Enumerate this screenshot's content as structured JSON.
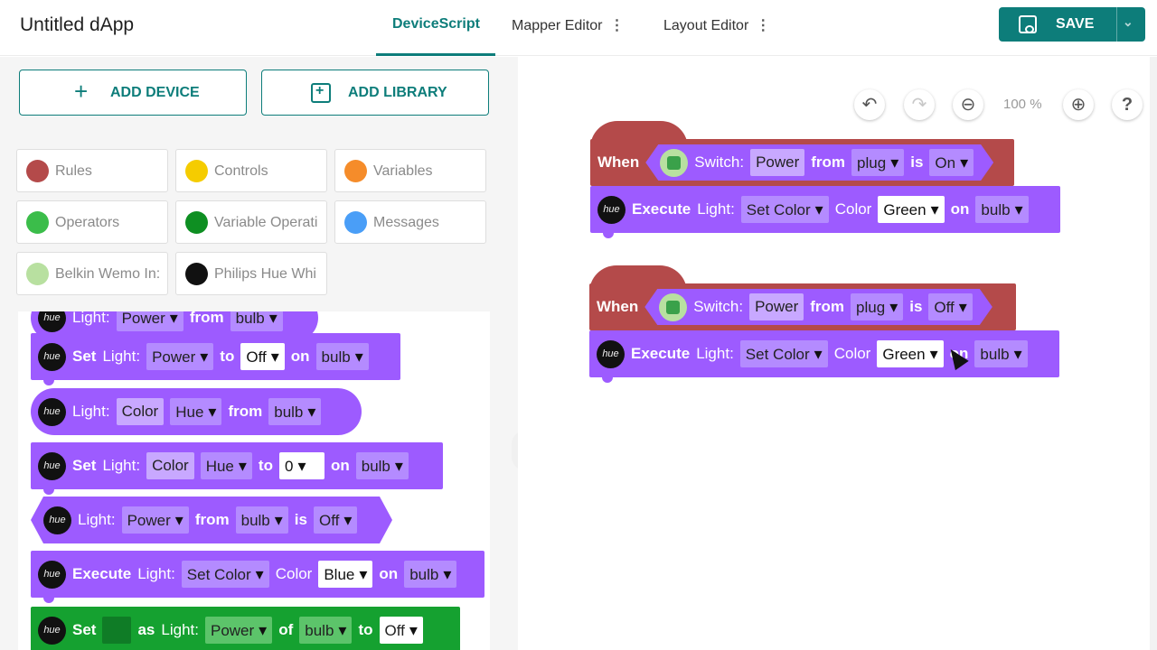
{
  "app": {
    "title": "Untitled dApp"
  },
  "tabs": [
    {
      "label": "DeviceScript"
    },
    {
      "label": "Mapper Editor"
    },
    {
      "label": "Layout Editor"
    }
  ],
  "save": {
    "label": "SAVE"
  },
  "left": {
    "add_device": "ADD DEVICE",
    "add_library": "ADD LIBRARY",
    "categories": [
      {
        "label": "Rules",
        "color": "#b44a4a"
      },
      {
        "label": "Controls",
        "color": "#f5cc00"
      },
      {
        "label": "Variables",
        "color": "#f58c2a"
      },
      {
        "label": "Operators",
        "color": "#3bbd4a"
      },
      {
        "label": "Variable Operati",
        "color": "#0e8f22"
      },
      {
        "label": "Messages",
        "color": "#4a9ef7"
      },
      {
        "label": "Belkin Wemo In:",
        "icon": "wemo-icon"
      },
      {
        "label": "Philips Hue Whi",
        "icon": "hue-icon"
      }
    ]
  },
  "palette": {
    "b1": {
      "device": "Light:",
      "prop": "Power",
      "from": "from",
      "src": "bulb"
    },
    "b2": {
      "set": "Set",
      "device": "Light:",
      "prop": "Power",
      "to": "to",
      "val": "Off",
      "on": "on",
      "target": "bulb"
    },
    "b3": {
      "device": "Light:",
      "prop": "Color",
      "sub": "Hue",
      "from": "from",
      "src": "bulb"
    },
    "b4": {
      "set": "Set",
      "device": "Light:",
      "prop": "Color",
      "sub": "Hue",
      "to": "to",
      "val": "0",
      "on": "on",
      "target": "bulb"
    },
    "b5": {
      "device": "Light:",
      "prop": "Power",
      "from": "from",
      "src": "bulb",
      "is": "is",
      "val": "Off"
    },
    "b6": {
      "exec": "Execute",
      "device": "Light:",
      "action": "Set Color",
      "color_lbl": "Color",
      "color": "Blue",
      "on": "on",
      "target": "bulb"
    },
    "b7": {
      "set": "Set",
      "as": "as",
      "device": "Light:",
      "prop": "Power",
      "of": "of",
      "src": "bulb",
      "to": "to",
      "val": "Off"
    }
  },
  "canvas": {
    "zoom": "100 %",
    "help": "?",
    "rule1": {
      "when": "When",
      "switch": "Switch:",
      "prop": "Power",
      "from": "from",
      "src": "plug",
      "is": "is",
      "state": "On",
      "exec": "Execute",
      "device": "Light:",
      "action": "Set Color",
      "color_lbl": "Color",
      "color": "Green",
      "on": "on",
      "target": "bulb"
    },
    "rule2": {
      "when": "When",
      "switch": "Switch:",
      "prop": "Power",
      "from": "from",
      "src": "plug",
      "is": "is",
      "state": "Off",
      "exec": "Execute",
      "device": "Light:",
      "action": "Set Color",
      "color_lbl": "Color",
      "color": "Green",
      "on": "on",
      "target": "bulb"
    }
  }
}
